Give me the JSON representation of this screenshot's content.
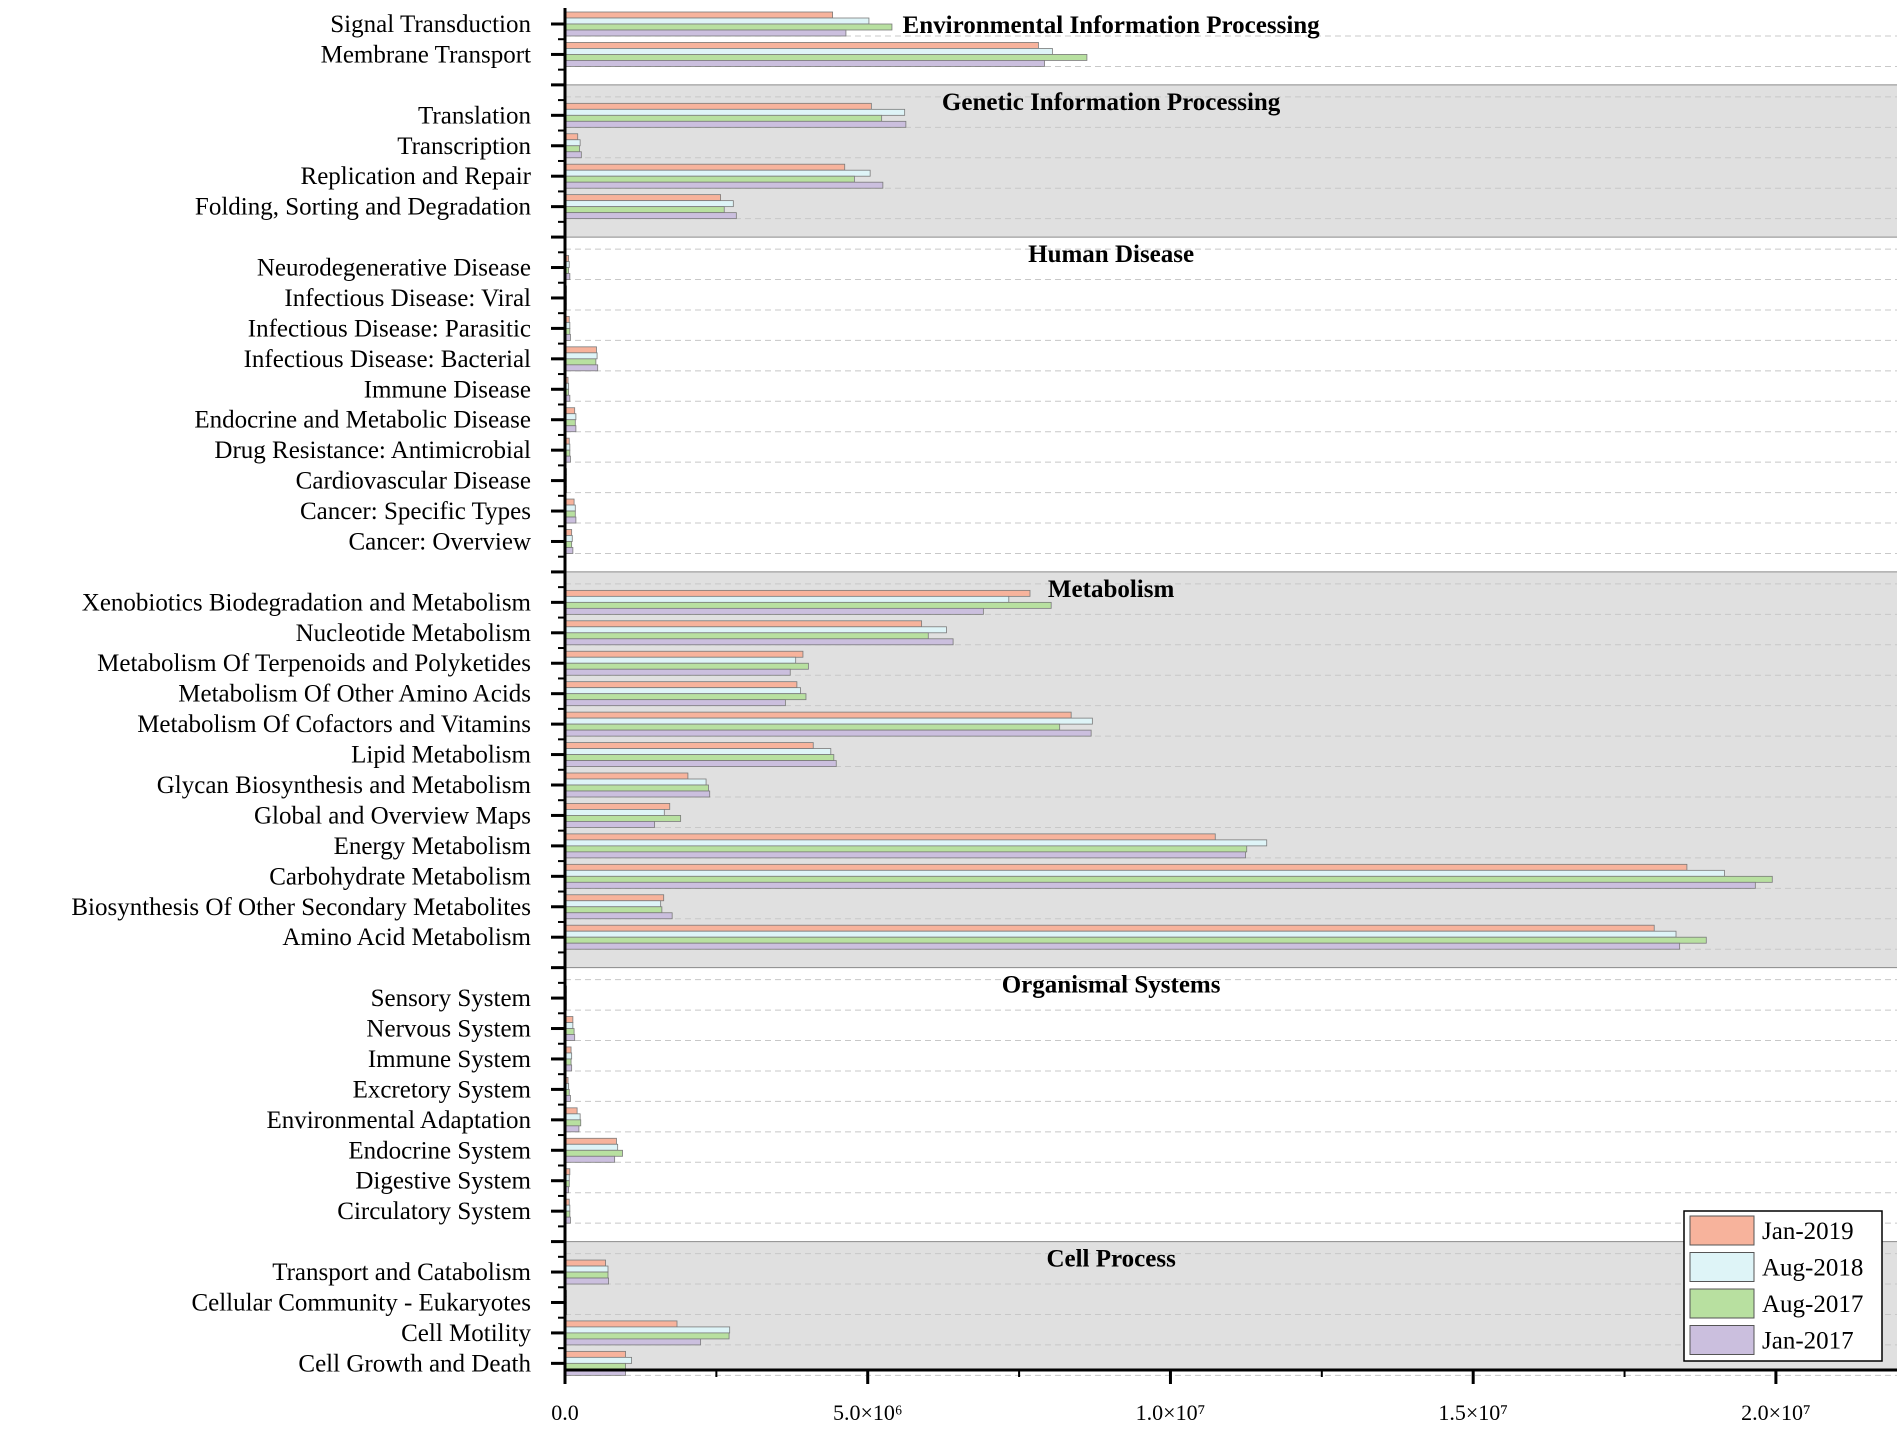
{
  "chart_data": {
    "type": "bar",
    "orientation": "horizontal",
    "xlim": [
      0,
      22000000
    ],
    "x_ticks": [
      {
        "value": 0,
        "label": "0.0"
      },
      {
        "value": 5000000,
        "label": "5.0×10⁶"
      },
      {
        "value": 10000000,
        "label": "1.0×10⁷"
      },
      {
        "value": 15000000,
        "label": "1.5×10⁷"
      },
      {
        "value": 20000000,
        "label": "2.0×10⁷"
      }
    ],
    "grid": "dashed horizontal",
    "legend_position": "bottom-right",
    "series": [
      {
        "name": "Jan-2019",
        "color": "#f7b39c"
      },
      {
        "name": "Aug-2018",
        "color": "#def4f7"
      },
      {
        "name": "Aug-2017",
        "color": "#b8e0a0"
      },
      {
        "name": "Jan-2017",
        "color": "#cbbfde"
      }
    ],
    "groups": [
      {
        "title": "Environmental Information Processing",
        "shaded": false,
        "categories": [
          {
            "label": "Signal Transduction",
            "values": [
              4420000,
              5020000,
              5400000,
              4640000
            ]
          },
          {
            "label": "Membrane Transport",
            "values": [
              7820000,
              8050000,
              8620000,
              7920000
            ]
          }
        ]
      },
      {
        "title": "Genetic Information Processing",
        "shaded": true,
        "categories": [
          {
            "label": "Translation",
            "values": [
              5060000,
              5610000,
              5230000,
              5630000
            ]
          },
          {
            "label": "Transcription",
            "values": [
              210000,
              250000,
              240000,
              270000
            ]
          },
          {
            "label": "Replication and Repair",
            "values": [
              4620000,
              5040000,
              4780000,
              5250000
            ]
          },
          {
            "label": "Folding, Sorting and Degradation",
            "values": [
              2570000,
              2780000,
              2630000,
              2830000
            ]
          }
        ]
      },
      {
        "title": "Human Disease",
        "shaded": false,
        "categories": [
          {
            "label": "Neurodegenerative Disease",
            "values": [
              60000,
              70000,
              60000,
              80000
            ]
          },
          {
            "label": "Infectious Disease: Viral",
            "values": [
              10000,
              10000,
              10000,
              10000
            ]
          },
          {
            "label": "Infectious Disease: Parasitic",
            "values": [
              70000,
              80000,
              80000,
              90000
            ]
          },
          {
            "label": "Infectious Disease: Bacterial",
            "values": [
              520000,
              530000,
              510000,
              540000
            ]
          },
          {
            "label": "Immune Disease",
            "values": [
              50000,
              60000,
              60000,
              80000
            ]
          },
          {
            "label": "Endocrine and Metabolic Disease",
            "values": [
              160000,
              180000,
              170000,
              180000
            ]
          },
          {
            "label": "Drug Resistance: Antimicrobial",
            "values": [
              70000,
              80000,
              80000,
              90000
            ]
          },
          {
            "label": "Cardiovascular Disease",
            "values": [
              10000,
              10000,
              10000,
              10000
            ]
          },
          {
            "label": "Cancer: Specific Types",
            "values": [
              150000,
              170000,
              170000,
              180000
            ]
          },
          {
            "label": "Cancer: Overview",
            "values": [
              110000,
              120000,
              110000,
              130000
            ]
          }
        ]
      },
      {
        "title": "Metabolism",
        "shaded": true,
        "categories": [
          {
            "label": "Xenobiotics Biodegradation and Metabolism",
            "values": [
              7680000,
              7330000,
              8030000,
              6910000
            ]
          },
          {
            "label": "Nucleotide Metabolism",
            "values": [
              5890000,
              6300000,
              6000000,
              6410000
            ]
          },
          {
            "label": "Metabolism Of Terpenoids and Polyketides",
            "values": [
              3930000,
              3810000,
              4020000,
              3720000
            ]
          },
          {
            "label": "Metabolism Of Other Amino Acids",
            "values": [
              3830000,
              3890000,
              3980000,
              3640000
            ]
          },
          {
            "label": "Metabolism Of Cofactors and Vitamins",
            "values": [
              8360000,
              8710000,
              8170000,
              8690000
            ]
          },
          {
            "label": "Lipid Metabolism",
            "values": [
              4100000,
              4390000,
              4440000,
              4480000
            ]
          },
          {
            "label": "Glycan Biosynthesis and Metabolism",
            "values": [
              2030000,
              2330000,
              2370000,
              2390000
            ]
          },
          {
            "label": "Global and Overview Maps",
            "values": [
              1730000,
              1640000,
              1910000,
              1480000
            ]
          },
          {
            "label": "Energy Metabolism",
            "values": [
              10740000,
              11590000,
              11260000,
              11240000
            ]
          },
          {
            "label": "Carbohydrate Metabolism",
            "values": [
              18530000,
              19150000,
              19940000,
              19660000
            ]
          },
          {
            "label": "Biosynthesis Of Other Secondary Metabolites",
            "values": [
              1630000,
              1580000,
              1600000,
              1770000
            ]
          },
          {
            "label": "Amino Acid Metabolism",
            "values": [
              17990000,
              18350000,
              18850000,
              18410000
            ]
          }
        ]
      },
      {
        "title": "Organismal Systems",
        "shaded": false,
        "categories": [
          {
            "label": "Sensory System",
            "values": [
              10000,
              10000,
              10000,
              10000
            ]
          },
          {
            "label": "Nervous System",
            "values": [
              130000,
              130000,
              150000,
              160000
            ]
          },
          {
            "label": "Immune System",
            "values": [
              100000,
              110000,
              100000,
              110000
            ]
          },
          {
            "label": "Excretory System",
            "values": [
              50000,
              60000,
              70000,
              90000
            ]
          },
          {
            "label": "Environmental Adaptation",
            "values": [
              200000,
              250000,
              260000,
              230000
            ]
          },
          {
            "label": "Endocrine System",
            "values": [
              850000,
              870000,
              950000,
              820000
            ]
          },
          {
            "label": "Digestive System",
            "values": [
              80000,
              70000,
              70000,
              60000
            ]
          },
          {
            "label": "Circulatory System",
            "values": [
              70000,
              80000,
              80000,
              90000
            ]
          }
        ]
      },
      {
        "title": "Cell Process",
        "shaded": true,
        "categories": [
          {
            "label": "Transport and Catabolism",
            "values": [
              670000,
              710000,
              710000,
              720000
            ]
          },
          {
            "label": "Cellular Community - Eukaryotes",
            "values": [
              10000,
              10000,
              10000,
              10000
            ]
          },
          {
            "label": "Cell Motility",
            "values": [
              1850000,
              2720000,
              2710000,
              2240000
            ]
          },
          {
            "label": "Cell Growth and Death",
            "values": [
              1000000,
              1100000,
              1000000,
              1000000
            ]
          }
        ]
      }
    ]
  }
}
